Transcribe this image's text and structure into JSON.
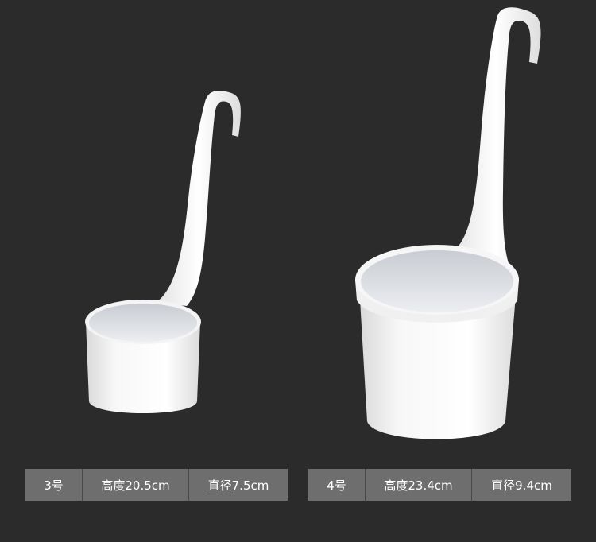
{
  "products": [
    {
      "size": "3号",
      "height": "高度20.5cm",
      "diameter": "直径7.5cm"
    },
    {
      "size": "4号",
      "height": "高度23.4cm",
      "diameter": "直径9.4cm"
    }
  ],
  "colors": {
    "background": "#2b2b2b",
    "ladle": "#f2f2f2",
    "label_bg": "#6e6e6e",
    "label_text": "#ffffff"
  }
}
